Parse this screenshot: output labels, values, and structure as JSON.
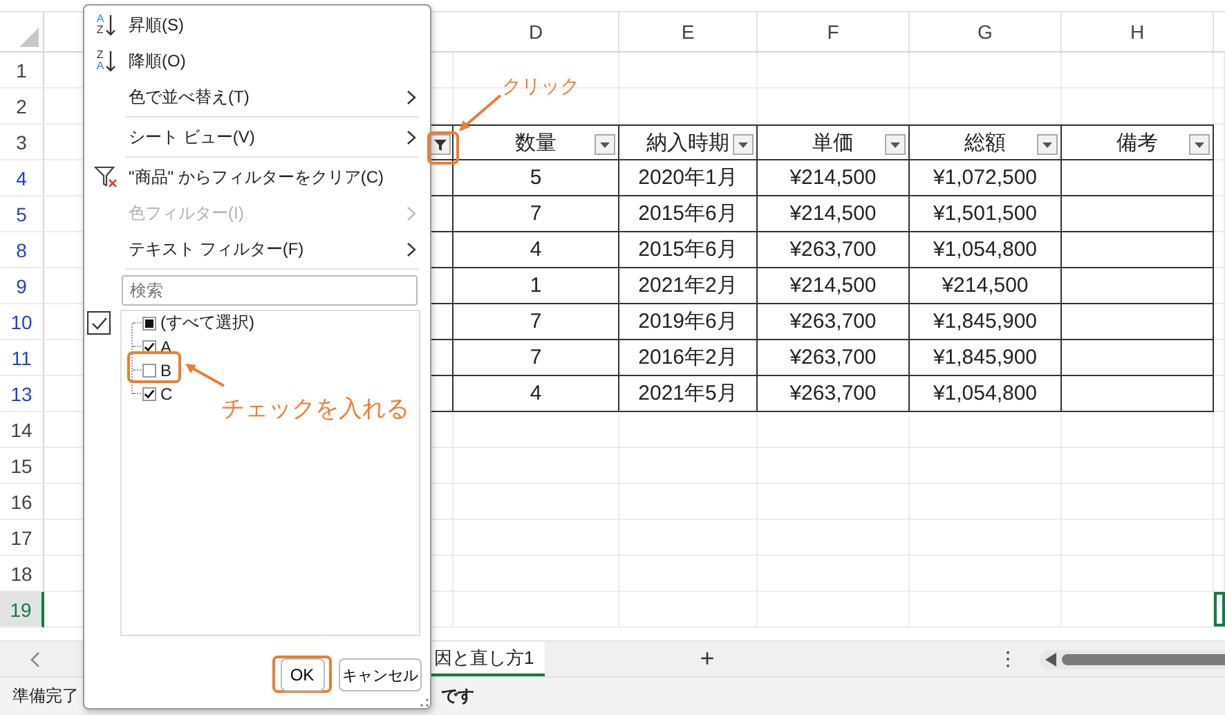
{
  "sheet": {
    "columns": [
      {
        "label": "D"
      },
      {
        "label": "E"
      },
      {
        "label": "F"
      },
      {
        "label": "G"
      },
      {
        "label": "H"
      }
    ],
    "rows": [
      {
        "label": "1",
        "kind": "normal"
      },
      {
        "label": "2",
        "kind": "normal"
      },
      {
        "label": "3",
        "kind": "normal"
      },
      {
        "label": "4",
        "kind": "filtered"
      },
      {
        "label": "5",
        "kind": "filtered"
      },
      {
        "label": "8",
        "kind": "filtered"
      },
      {
        "label": "9",
        "kind": "filtered"
      },
      {
        "label": "10",
        "kind": "filtered"
      },
      {
        "label": "11",
        "kind": "filtered"
      },
      {
        "label": "13",
        "kind": "filtered"
      },
      {
        "label": "14",
        "kind": "normal"
      },
      {
        "label": "15",
        "kind": "normal"
      },
      {
        "label": "16",
        "kind": "normal"
      },
      {
        "label": "17",
        "kind": "normal"
      },
      {
        "label": "18",
        "kind": "normal"
      },
      {
        "label": "19",
        "kind": "active"
      }
    ],
    "table": {
      "filter_applied_column": {
        "filter_applied": true
      },
      "columns": [
        {
          "label": "数量"
        },
        {
          "label": "納入時期"
        },
        {
          "label": "単価"
        },
        {
          "label": "総額"
        },
        {
          "label": "備考"
        }
      ],
      "rows": [
        [
          "5",
          "2020年1月",
          "¥214,500",
          "¥1,072,500",
          ""
        ],
        [
          "7",
          "2015年6月",
          "¥214,500",
          "¥1,501,500",
          ""
        ],
        [
          "4",
          "2015年6月",
          "¥263,700",
          "¥1,054,800",
          ""
        ],
        [
          "1",
          "2021年2月",
          "¥214,500",
          "¥214,500",
          ""
        ],
        [
          "7",
          "2019年6月",
          "¥263,700",
          "¥1,845,900",
          ""
        ],
        [
          "7",
          "2016年2月",
          "¥263,700",
          "¥1,845,900",
          ""
        ],
        [
          "4",
          "2021年5月",
          "¥263,700",
          "¥1,054,800",
          ""
        ]
      ]
    }
  },
  "filter_menu": {
    "items": [
      {
        "label": "昇順(S)",
        "icon_letters": [
          "A",
          "Z"
        ],
        "submenu": false,
        "disabled": false
      },
      {
        "label": "降順(O)",
        "icon_letters": [
          "Z",
          "A"
        ],
        "submenu": false,
        "disabled": false
      },
      {
        "label": "色で並べ替え(T)",
        "submenu": true,
        "disabled": false,
        "separator_after": true
      },
      {
        "label": "シート ビュー(V)",
        "submenu": true,
        "disabled": false,
        "separator_after": true
      },
      {
        "label": "\"商品\" からフィルターをクリア(C)",
        "submenu": false,
        "disabled": false
      },
      {
        "label": "色フィルター(I)",
        "submenu": true,
        "disabled": true
      },
      {
        "label": "テキスト フィルター(F)",
        "submenu": true,
        "disabled": false,
        "separator_after": true
      }
    ],
    "search": {
      "placeholder": "検索"
    },
    "toggle": {
      "checked": true
    },
    "values": [
      {
        "label": "(すべて選択)",
        "mixed": true
      },
      {
        "label": "A",
        "checked": true
      },
      {
        "label": "B",
        "checked": false
      },
      {
        "label": "C",
        "checked": true
      }
    ],
    "buttons": [
      {
        "label": "OK"
      },
      {
        "label": "キャンセル"
      }
    ]
  },
  "sheet_tabs": {
    "tabs": [
      {
        "label": "因と直し方1",
        "selected": true
      }
    ],
    "add": "+",
    "more": "⋮"
  },
  "status_bar": {
    "left": "準備完了",
    "middle": "です"
  },
  "annotations": [
    {
      "text": "クリック"
    },
    {
      "text": "チェックを入れる"
    }
  ]
}
